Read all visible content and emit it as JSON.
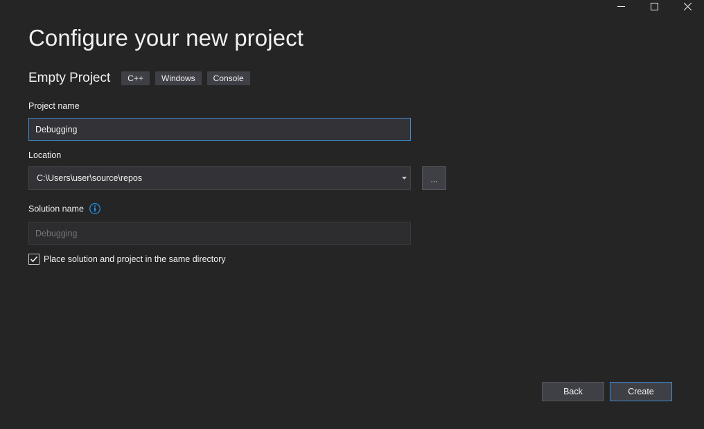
{
  "window": {
    "controls": {
      "minimize_icon": "minimize-icon",
      "maximize_icon": "maximize-icon",
      "close_icon": "close-icon"
    }
  },
  "page": {
    "title": "Configure your new project"
  },
  "template": {
    "name": "Empty Project",
    "tags": [
      "C++",
      "Windows",
      "Console"
    ]
  },
  "project_name": {
    "label": "Project name",
    "value": "Debugging"
  },
  "location": {
    "label": "Location",
    "value": "C:\\Users\\user\\source\\repos",
    "browse_label": "..."
  },
  "solution_name": {
    "label": "Solution name",
    "placeholder": "Debugging",
    "info_icon": "info-icon"
  },
  "same_directory": {
    "label": "Place solution and project in the same directory",
    "checked": true
  },
  "footer": {
    "back_label": "Back",
    "create_label": "Create"
  },
  "colors": {
    "background": "#252526",
    "input_background": "#333337",
    "focus_border": "#3e8bd4",
    "tag_background": "#3f3f46",
    "info_blue": "#1e90e6"
  }
}
